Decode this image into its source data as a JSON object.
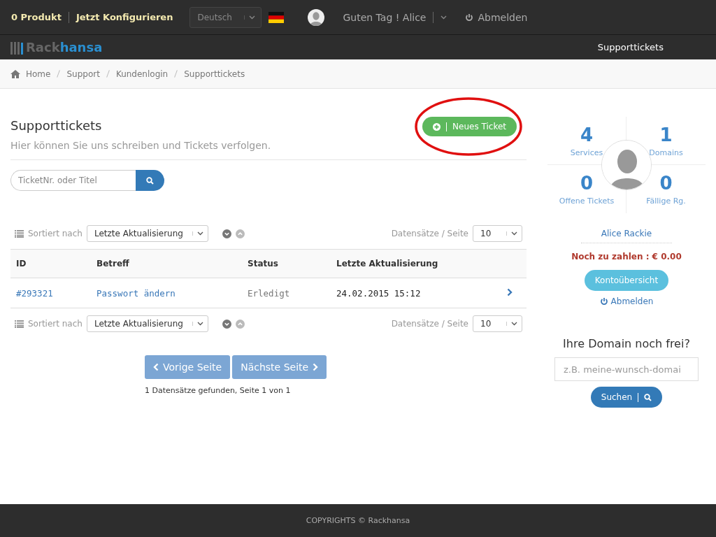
{
  "topbar": {
    "cart": "0 Produkt",
    "configure": "Jetzt Konfigurieren",
    "language": "Deutsch",
    "greeting": "Guten Tag ! Alice",
    "logout": "Abmelden"
  },
  "navbar": {
    "logo_start": "Rack",
    "logo_end": "hansa",
    "link": "Supporttickets"
  },
  "breadcrumb": [
    "Home",
    "Support",
    "Kundenlogin",
    "Supporttickets"
  ],
  "page": {
    "title": "Supporttickets",
    "subtitle": "Hier können Sie uns schreiben und Tickets verfolgen.",
    "new_ticket": "Neues Ticket",
    "search_placeholder": "TicketNr. oder Titel"
  },
  "toolbars": [
    {
      "sort_label": "Sortiert nach",
      "sort_value": "Letzte Aktualisierung",
      "per_page_label": "Datensätze / Seite",
      "per_page": "10"
    },
    {
      "sort_label": "Sortiert nach",
      "sort_value": "Letzte Aktualisierung",
      "per_page_label": "Datensätze / Seite",
      "per_page": "10"
    }
  ],
  "table": {
    "columns": [
      "ID",
      "Betreff",
      "Status",
      "Letzte Aktualisierung"
    ],
    "rows": [
      {
        "id": "#293321",
        "subject": "Passwort ändern",
        "status": "Erledigt",
        "updated": "24.02.2015 15:12"
      }
    ]
  },
  "pagination": {
    "prev": "Vorige Seite",
    "next": "Nächste Seite",
    "summary": "1 Datensätze gefunden, Seite 1 von 1"
  },
  "sidebar": {
    "stats": [
      {
        "value": "4",
        "label": "Services"
      },
      {
        "value": "1",
        "label": "Domains"
      },
      {
        "value": "0",
        "label": "Offene Tickets"
      },
      {
        "value": "0",
        "label": "Fällige Rg."
      }
    ],
    "name": "Alice Rackie",
    "balance": "Noch zu zahlen : € 0.00",
    "account_button": "Kontoübersicht",
    "logout": "Abmelden",
    "domain_title": "Ihre Domain noch frei?",
    "domain_placeholder": "z.B. meine-wunsch-domai",
    "domain_button": "Suchen"
  },
  "footer": "COPYRIGHTS © Rackhansa"
}
